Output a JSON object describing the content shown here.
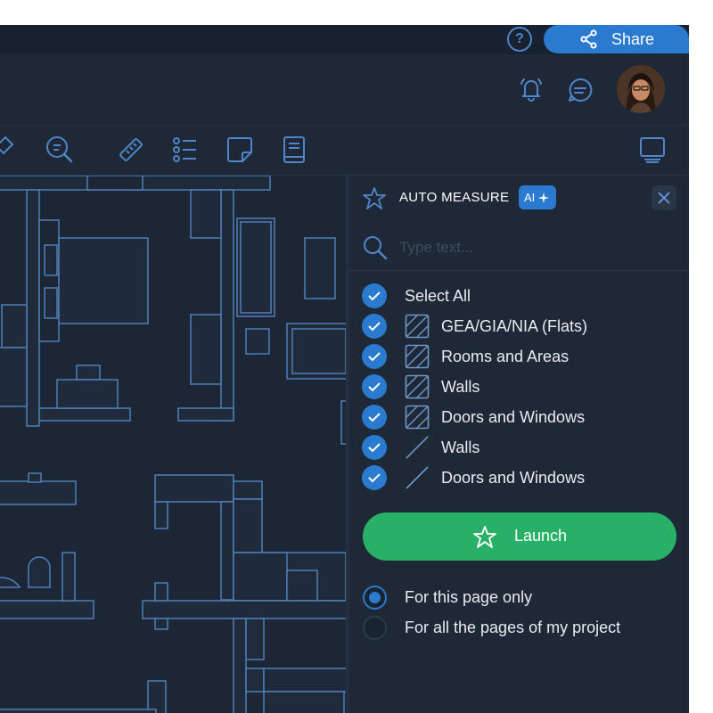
{
  "topbar": {
    "help_label": "?",
    "share_label": "Share"
  },
  "header": {
    "icons": [
      "bell-icon",
      "chat-icon"
    ],
    "avatar": "user-avatar"
  },
  "toolbar": {
    "tools": [
      "pin-icon",
      "search-zoom-icon",
      "ruler-icon",
      "list-icon",
      "sticky-note-icon",
      "book-icon",
      "monitor-icon"
    ]
  },
  "panel": {
    "title": "AUTO MEASURE",
    "ai_badge": "AI",
    "search_placeholder": "Type text...",
    "select_all": "Select All",
    "items": [
      {
        "label": "GEA/GIA/NIA (Flats)",
        "icon": "hatched-area-icon",
        "checked": true
      },
      {
        "label": "Rooms and Areas",
        "icon": "hatched-area-icon",
        "checked": true
      },
      {
        "label": "Walls",
        "icon": "hatched-area-icon",
        "checked": true
      },
      {
        "label": "Doors and Windows",
        "icon": "hatched-area-icon",
        "checked": true
      },
      {
        "label": "Walls",
        "icon": "line-icon",
        "checked": true
      },
      {
        "label": "Doors and Windows",
        "icon": "line-icon",
        "checked": true
      }
    ],
    "launch_label": "Launch",
    "scope_options": [
      {
        "label": "For this page only",
        "selected": true
      },
      {
        "label": "For all the pages of my project",
        "selected": false
      }
    ]
  },
  "colors": {
    "accent": "#2a7bd0",
    "launch": "#29b067",
    "background": "#1b2533",
    "blueprint_line": "#4f7fb8"
  }
}
